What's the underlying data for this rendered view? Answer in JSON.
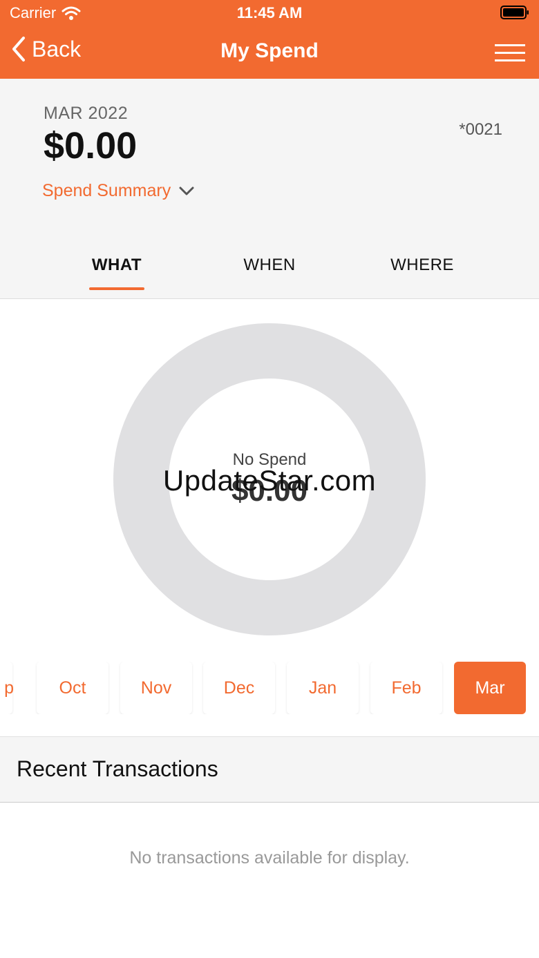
{
  "status_bar": {
    "carrier": "Carrier",
    "time": "11:45 AM"
  },
  "nav": {
    "back_label": "Back",
    "title": "My Spend"
  },
  "summary": {
    "period": "MAR 2022",
    "amount": "$0.00",
    "account": "*0021",
    "spend_summary_label": "Spend Summary"
  },
  "tabs": [
    {
      "label": "WHAT",
      "active": true
    },
    {
      "label": "WHEN",
      "active": false
    },
    {
      "label": "WHERE",
      "active": false
    }
  ],
  "donut": {
    "label": "No Spend",
    "amount": "$0.00",
    "ring_color": "#e0e0e2"
  },
  "watermark": "UpdateStar.com",
  "months": [
    {
      "label": "p",
      "active": false
    },
    {
      "label": "Oct",
      "active": false
    },
    {
      "label": "Nov",
      "active": false
    },
    {
      "label": "Dec",
      "active": false
    },
    {
      "label": "Jan",
      "active": false
    },
    {
      "label": "Feb",
      "active": false
    },
    {
      "label": "Mar",
      "active": true
    }
  ],
  "recent": {
    "title": "Recent Transactions",
    "empty_message": "No transactions available for display."
  },
  "colors": {
    "accent": "#f26a30",
    "panel": "#f5f5f5"
  }
}
